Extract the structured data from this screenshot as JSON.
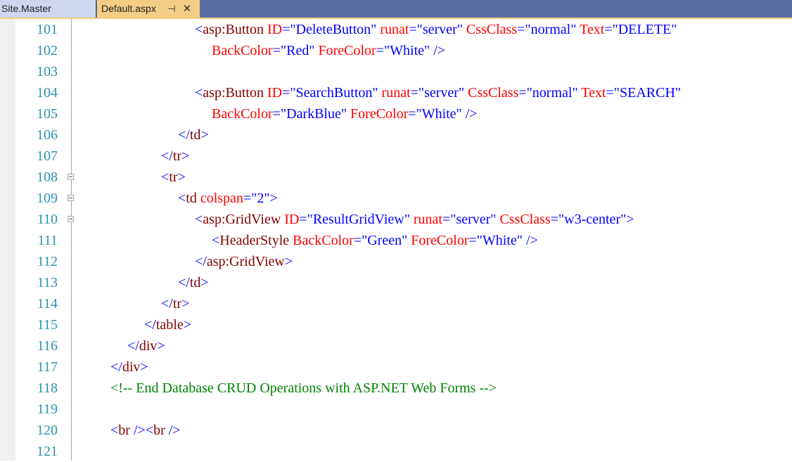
{
  "tabs": {
    "site_master": "Site.Master",
    "default_aspx": "Default.aspx",
    "pin_glyph": "⊣",
    "close_glyph": "✕"
  },
  "colors": {
    "tag_bracket": "#0000ff",
    "element_name": "#800000",
    "attribute_name": "#ff0000",
    "attribute_value": "#0000ff",
    "comment": "#008000",
    "line_number": "#2b91af",
    "active_tab": "#f5cc84",
    "tab_bar": "#5c6fa3"
  },
  "lines": [
    {
      "num": "101",
      "fold": false,
      "indent": 5,
      "tokens": [
        {
          "c": "b",
          "t": "<"
        },
        {
          "c": "m",
          "t": "asp:Button"
        },
        {
          "c": "r",
          "t": " ID"
        },
        {
          "c": "b",
          "t": "=\"DeleteButton\""
        },
        {
          "c": "r",
          "t": " runat"
        },
        {
          "c": "b",
          "t": "=\"server\""
        },
        {
          "c": "r",
          "t": " CssClass"
        },
        {
          "c": "b",
          "t": "=\"normal\""
        },
        {
          "c": "r",
          "t": " Text"
        },
        {
          "c": "b",
          "t": "=\"DELETE\""
        }
      ]
    },
    {
      "num": "102",
      "fold": false,
      "indent": 6,
      "tokens": [
        {
          "c": "r",
          "t": "BackColor"
        },
        {
          "c": "b",
          "t": "=\"Red\""
        },
        {
          "c": "r",
          "t": " ForeColor"
        },
        {
          "c": "b",
          "t": "=\"White\""
        },
        {
          "c": "b",
          "t": " />"
        }
      ]
    },
    {
      "num": "103",
      "fold": false,
      "indent": 0,
      "tokens": []
    },
    {
      "num": "104",
      "fold": false,
      "indent": 5,
      "tokens": [
        {
          "c": "b",
          "t": "<"
        },
        {
          "c": "m",
          "t": "asp:Button"
        },
        {
          "c": "r",
          "t": " ID"
        },
        {
          "c": "b",
          "t": "=\"SearchButton\""
        },
        {
          "c": "r",
          "t": " runat"
        },
        {
          "c": "b",
          "t": "=\"server\""
        },
        {
          "c": "r",
          "t": " CssClass"
        },
        {
          "c": "b",
          "t": "=\"normal\""
        },
        {
          "c": "r",
          "t": " Text"
        },
        {
          "c": "b",
          "t": "=\"SEARCH\""
        }
      ]
    },
    {
      "num": "105",
      "fold": false,
      "indent": 6,
      "tokens": [
        {
          "c": "r",
          "t": "BackColor"
        },
        {
          "c": "b",
          "t": "=\"DarkBlue\""
        },
        {
          "c": "r",
          "t": " ForeColor"
        },
        {
          "c": "b",
          "t": "=\"White\""
        },
        {
          "c": "b",
          "t": " />"
        }
      ]
    },
    {
      "num": "106",
      "fold": false,
      "indent": 4,
      "tokens": [
        {
          "c": "b",
          "t": "</"
        },
        {
          "c": "m",
          "t": "td"
        },
        {
          "c": "b",
          "t": ">"
        }
      ]
    },
    {
      "num": "107",
      "fold": false,
      "indent": 3,
      "tokens": [
        {
          "c": "b",
          "t": "</"
        },
        {
          "c": "m",
          "t": "tr"
        },
        {
          "c": "b",
          "t": ">"
        }
      ]
    },
    {
      "num": "108",
      "fold": true,
      "indent": 3,
      "tokens": [
        {
          "c": "b",
          "t": "<"
        },
        {
          "c": "m",
          "t": "tr"
        },
        {
          "c": "b",
          "t": ">"
        }
      ]
    },
    {
      "num": "109",
      "fold": true,
      "indent": 4,
      "tokens": [
        {
          "c": "b",
          "t": "<"
        },
        {
          "c": "m",
          "t": "td"
        },
        {
          "c": "r",
          "t": " colspan"
        },
        {
          "c": "b",
          "t": "=\"2\""
        },
        {
          "c": "b",
          "t": ">"
        }
      ]
    },
    {
      "num": "110",
      "fold": true,
      "indent": 5,
      "tokens": [
        {
          "c": "b",
          "t": "<"
        },
        {
          "c": "m",
          "t": "asp:GridView"
        },
        {
          "c": "r",
          "t": " ID"
        },
        {
          "c": "b",
          "t": "=\"ResultGridView\""
        },
        {
          "c": "r",
          "t": " runat"
        },
        {
          "c": "b",
          "t": "=\"server\""
        },
        {
          "c": "r",
          "t": " CssClass"
        },
        {
          "c": "b",
          "t": "=\"w3-center\""
        },
        {
          "c": "b",
          "t": ">"
        }
      ]
    },
    {
      "num": "111",
      "fold": false,
      "indent": 6,
      "tokens": [
        {
          "c": "b",
          "t": "<"
        },
        {
          "c": "m",
          "t": "HeaderStyle"
        },
        {
          "c": "r",
          "t": " BackColor"
        },
        {
          "c": "b",
          "t": "=\"Green\""
        },
        {
          "c": "r",
          "t": " ForeColor"
        },
        {
          "c": "b",
          "t": "=\"White\""
        },
        {
          "c": "b",
          "t": " />"
        }
      ]
    },
    {
      "num": "112",
      "fold": false,
      "indent": 5,
      "tokens": [
        {
          "c": "b",
          "t": "</"
        },
        {
          "c": "m",
          "t": "asp:GridView"
        },
        {
          "c": "b",
          "t": ">"
        }
      ]
    },
    {
      "num": "113",
      "fold": false,
      "indent": 4,
      "tokens": [
        {
          "c": "b",
          "t": "</"
        },
        {
          "c": "m",
          "t": "td"
        },
        {
          "c": "b",
          "t": ">"
        }
      ]
    },
    {
      "num": "114",
      "fold": false,
      "indent": 3,
      "tokens": [
        {
          "c": "b",
          "t": "</"
        },
        {
          "c": "m",
          "t": "tr"
        },
        {
          "c": "b",
          "t": ">"
        }
      ]
    },
    {
      "num": "115",
      "fold": false,
      "indent": 2,
      "tokens": [
        {
          "c": "b",
          "t": "</"
        },
        {
          "c": "m",
          "t": "table"
        },
        {
          "c": "b",
          "t": ">"
        }
      ]
    },
    {
      "num": "116",
      "fold": false,
      "indent": 1,
      "tokens": [
        {
          "c": "b",
          "t": "</"
        },
        {
          "c": "m",
          "t": "div"
        },
        {
          "c": "b",
          "t": ">"
        }
      ]
    },
    {
      "num": "117",
      "fold": false,
      "indent": 0,
      "tokens": [
        {
          "c": "b",
          "t": "</"
        },
        {
          "c": "m",
          "t": "div"
        },
        {
          "c": "b",
          "t": ">"
        }
      ]
    },
    {
      "num": "118",
      "fold": false,
      "indent": 0,
      "tokens": [
        {
          "c": "g",
          "t": "<!-- End Database CRUD Operations with ASP.NET Web Forms -->"
        }
      ]
    },
    {
      "num": "119",
      "fold": false,
      "indent": 0,
      "tokens": []
    },
    {
      "num": "120",
      "fold": false,
      "indent": 0,
      "tokens": [
        {
          "c": "b",
          "t": "<"
        },
        {
          "c": "m",
          "t": "br"
        },
        {
          "c": "b",
          "t": " /><"
        },
        {
          "c": "m",
          "t": "br"
        },
        {
          "c": "b",
          "t": " />"
        }
      ]
    },
    {
      "num": "121",
      "fold": false,
      "indent": 0,
      "tokens": []
    }
  ]
}
